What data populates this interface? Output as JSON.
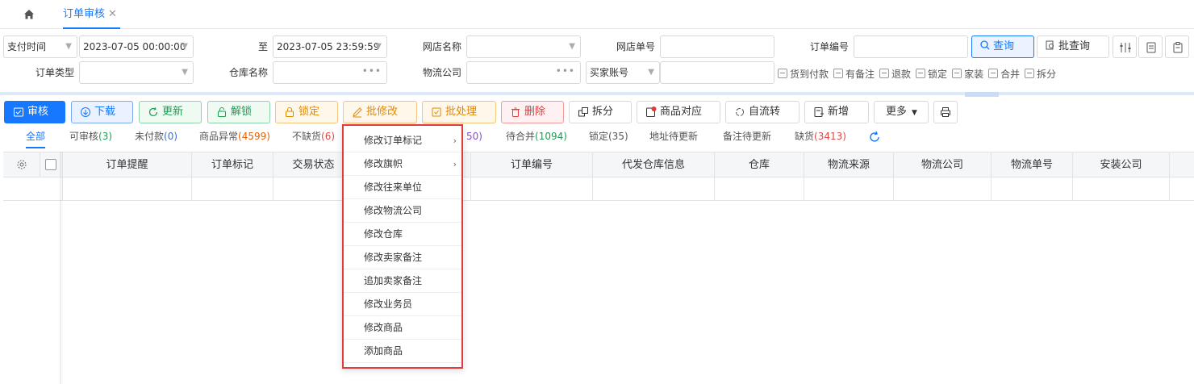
{
  "tabs": {
    "active_label": "订单审核"
  },
  "filters": {
    "pay_time_label": "支付时间",
    "start_time": "2023-07-05 00:00:00",
    "to_label": "至",
    "end_time": "2023-07-05 23:59:59",
    "shop_name_label": "网店名称",
    "shop_order_label": "网店单号",
    "order_no_label": "订单编号",
    "query_label": "查询",
    "batch_query_label": "批查询",
    "order_type_label": "订单类型",
    "warehouse_label": "仓库名称",
    "logistics_label": "物流公司",
    "buyer_account_label": "买家账号",
    "checkboxes": [
      "货到付款",
      "有备注",
      "退款",
      "锁定",
      "家装",
      "合并",
      "拆分"
    ]
  },
  "toolbar": {
    "audit": "审核",
    "download": "下载",
    "refresh": "更新",
    "unlock": "解锁",
    "lock": "锁定",
    "batch_modify": "批修改",
    "batch_process": "批处理",
    "delete": "删除",
    "split": "拆分",
    "product_match": "商品对应",
    "self_transfer": "自流转",
    "add": "新增",
    "more": "更多"
  },
  "status_tabs": {
    "all": "全部",
    "auditable": "可审核",
    "auditable_count": "(3)",
    "unpaid": "未付款",
    "unpaid_count": "(0)",
    "abnormal": "商品异常",
    "abnormal_count": "(4599)",
    "not_short": "不缺货",
    "not_short_count": "(6)",
    "partial_count": "50)",
    "to_merge": "待合并",
    "to_merge_count": "(1094)",
    "locked": "锁定(35)",
    "addr_update": "地址待更新",
    "remark_update": "备注待更新",
    "short": "缺货",
    "short_count": "(3413)"
  },
  "table": {
    "columns": [
      "订单提醒",
      "订单标记",
      "交易状态",
      "订单编号",
      "代发仓库信息",
      "仓库",
      "物流来源",
      "物流公司",
      "物流单号",
      "安装公司"
    ]
  },
  "context_menu": {
    "items": [
      {
        "label": "修改订单标记",
        "submenu": true
      },
      {
        "label": "修改旗帜",
        "submenu": true
      },
      {
        "label": "修改往来单位",
        "submenu": false
      },
      {
        "label": "修改物流公司",
        "submenu": false
      },
      {
        "label": "修改仓库",
        "submenu": false
      },
      {
        "label": "修改卖家备注",
        "submenu": false
      },
      {
        "label": "追加卖家备注",
        "submenu": false
      },
      {
        "label": "修改业务员",
        "submenu": false
      },
      {
        "label": "修改商品",
        "submenu": false
      },
      {
        "label": "添加商品",
        "submenu": false
      }
    ],
    "highlight_color": "#e23b3b"
  },
  "colors": {
    "accent": "#1677ff"
  }
}
